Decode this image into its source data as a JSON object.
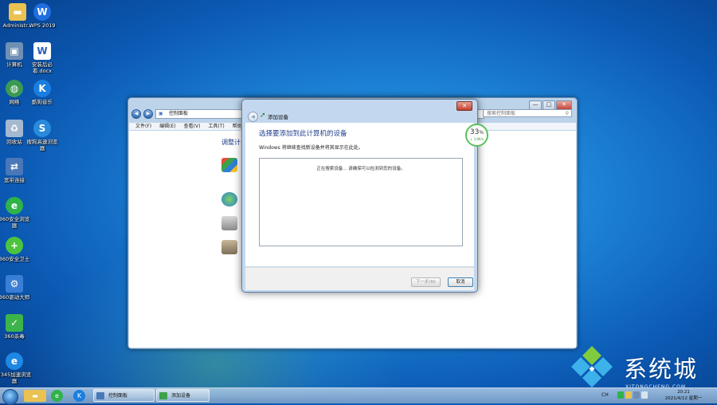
{
  "desktop": {
    "icons": [
      {
        "label": "Administr...",
        "icon": "folder-icon",
        "color": "#e9c251"
      },
      {
        "label": "WPS 2019",
        "icon": "wps-icon",
        "color": "#1f6fe0"
      },
      {
        "label": "计算机",
        "icon": "computer-icon",
        "color": "#6f8fb5"
      },
      {
        "label": "安装后必看.docx",
        "icon": "word-doc-icon",
        "color": "#2b5fb8"
      },
      {
        "label": "网络",
        "icon": "network-icon",
        "color": "#3b9a52"
      },
      {
        "label": "酷狗音乐",
        "icon": "kugou-icon",
        "color": "#1a7ee0"
      },
      {
        "label": "回收站",
        "icon": "recycle-bin-icon",
        "color": "#a4b9d0"
      },
      {
        "label": "搜狗高速浏览器",
        "icon": "sogou-browser-icon",
        "color": "#2a8bdc"
      },
      {
        "label": "宽带连接",
        "icon": "broadband-icon",
        "color": "#4a77b8"
      },
      {
        "label": "360安全浏览器",
        "icon": "360-browser-icon",
        "color": "#2fb24a"
      },
      {
        "label": "360安全卫士",
        "icon": "360-security-icon",
        "color": "#4cc43e"
      },
      {
        "label": "360驱动大师",
        "icon": "360-driver-icon",
        "color": "#3a7fd6"
      },
      {
        "label": "360杀毒",
        "icon": "360-antivirus-icon",
        "color": "#3db44a"
      },
      {
        "label": "2345加速浏览器",
        "icon": "2345-browser-icon",
        "color": "#1e88e5"
      }
    ]
  },
  "control_panel": {
    "breadcrumb": "控制面板",
    "search_placeholder": "搜索控制面板",
    "menu": [
      "文件(F)",
      "编辑(E)",
      "查看(V)",
      "工具(T)",
      "帮助(H)"
    ],
    "heading": "调整计",
    "caption_min": "—",
    "caption_max": "□",
    "caption_close": "✕"
  },
  "dialog": {
    "title": "添加设备",
    "heading": "选择要添加到此计算机的设备",
    "subtitle": "Windows 将继续查找新设备并将其显示在此处。",
    "searching": "正在搜索设备... 请确保可以检测到您的设备。",
    "next_button": "下一步(N)",
    "cancel_button": "取消",
    "close": "✕"
  },
  "progress_badge": {
    "percent": "33",
    "percent_sign": "%",
    "speed": "↓ 3.8K/s"
  },
  "watermark": {
    "title": "系统城",
    "url": "XITONGCHENG.COM"
  },
  "taskbar": {
    "tasks": [
      {
        "label": "控制面板",
        "icon": "control-panel-icon"
      },
      {
        "label": "添加设备",
        "icon": "add-device-icon"
      }
    ],
    "language": "CH",
    "time": "20:21",
    "date": "2021/4/12 星期一"
  }
}
